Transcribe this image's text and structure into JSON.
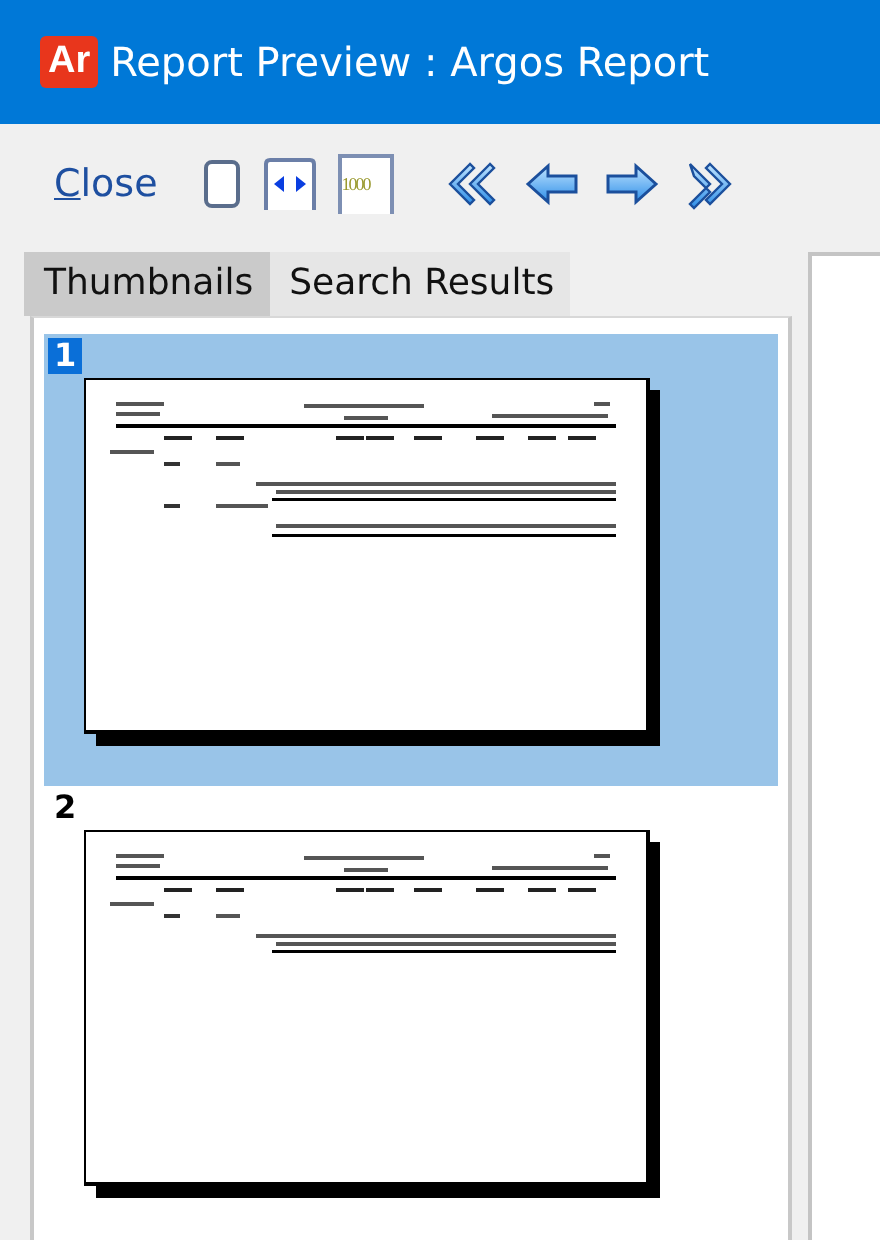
{
  "window": {
    "title": "Report Preview : Argos Report",
    "app_badge": "Ar"
  },
  "toolbar": [
    {
      "kind": "link",
      "label": "Close"
    },
    {
      "kind": "page"
    },
    {
      "kind": "fit-width"
    },
    {
      "kind": "zoom",
      "label": "1000"
    },
    {
      "kind": "first"
    },
    {
      "kind": "prev"
    },
    {
      "kind": "next"
    },
    {
      "kind": "last"
    }
  ],
  "tabs": [
    {
      "label": "Thumbnails",
      "selected": true
    },
    {
      "label": "Search Results",
      "selected": false
    }
  ],
  "thumbnails": [
    {
      "number": "1",
      "selected": true
    },
    {
      "number": "2",
      "selected": false
    }
  ]
}
